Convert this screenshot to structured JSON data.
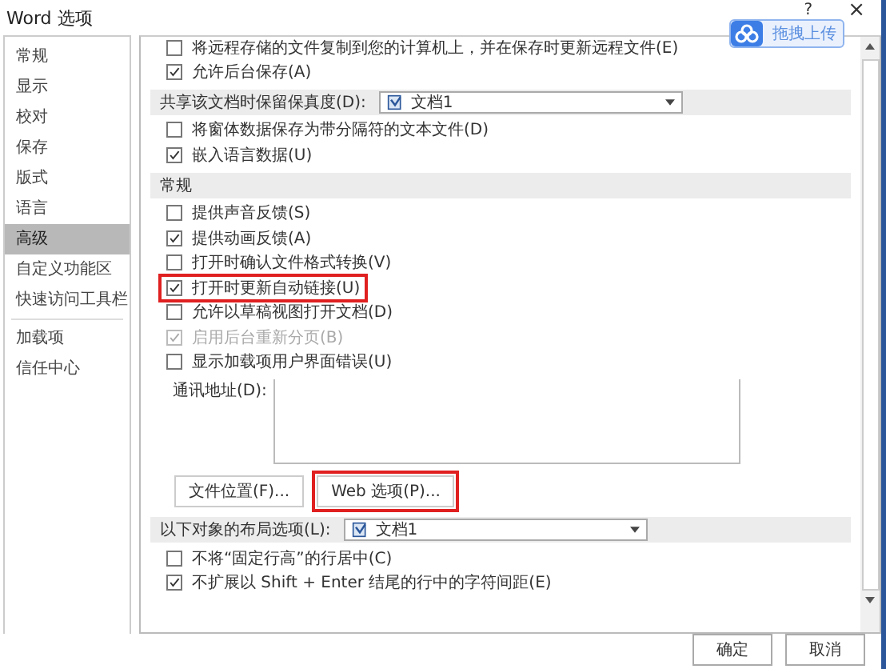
{
  "window": {
    "title": "Word 选项",
    "help": "?",
    "close": "×"
  },
  "upload_badge": {
    "label": "拖拽上传"
  },
  "sidebar": {
    "groups": [
      [
        {
          "label": "常规",
          "selected": false
        },
        {
          "label": "显示",
          "selected": false
        },
        {
          "label": "校对",
          "selected": false
        },
        {
          "label": "保存",
          "selected": false
        },
        {
          "label": "版式",
          "selected": false
        },
        {
          "label": "语言",
          "selected": false
        },
        {
          "label": "高级",
          "selected": true
        },
        {
          "label": "自定义功能区",
          "selected": false
        },
        {
          "label": "快速访问工具栏",
          "selected": false
        }
      ],
      [
        {
          "label": "加载项",
          "selected": false
        },
        {
          "label": "信任中心",
          "selected": false
        }
      ]
    ]
  },
  "content": {
    "rows": [
      {
        "kind": "checkbox",
        "label": "将远程存储的文件复制到您的计算机上，并在保存时更新远程文件(E)",
        "checked": false,
        "disabled": false,
        "highlighted": false
      },
      {
        "kind": "checkbox",
        "label": "允许后台保存(A)",
        "checked": true,
        "disabled": false,
        "highlighted": false
      },
      {
        "kind": "header",
        "label": "共享该文档时保留保真度(D):",
        "select": "文档1"
      },
      {
        "kind": "checkbox",
        "label": "将窗体数据保存为带分隔符的文本文件(D)",
        "checked": false,
        "disabled": false,
        "highlighted": false
      },
      {
        "kind": "checkbox",
        "label": "嵌入语言数据(U)",
        "checked": true,
        "disabled": false,
        "highlighted": false
      },
      {
        "kind": "header",
        "label": "常规"
      },
      {
        "kind": "checkbox",
        "label": "提供声音反馈(S)",
        "checked": false,
        "disabled": false,
        "highlighted": false
      },
      {
        "kind": "checkbox",
        "label": "提供动画反馈(A)",
        "checked": true,
        "disabled": false,
        "highlighted": false
      },
      {
        "kind": "checkbox",
        "label": "打开时确认文件格式转换(V)",
        "checked": false,
        "disabled": false,
        "highlighted": false
      },
      {
        "kind": "checkbox",
        "label": "打开时更新自动链接(U)",
        "checked": true,
        "disabled": false,
        "highlighted": true
      },
      {
        "kind": "checkbox",
        "label": "允许以草稿视图打开文档(D)",
        "checked": false,
        "disabled": false,
        "highlighted": false
      },
      {
        "kind": "checkbox",
        "label": "启用后台重新分页(B)",
        "checked": true,
        "disabled": true,
        "highlighted": false
      },
      {
        "kind": "checkbox",
        "label": "显示加载项用户界面错误(U)",
        "checked": false,
        "disabled": false,
        "highlighted": false
      },
      {
        "kind": "address",
        "label": "通讯地址(D):"
      },
      {
        "kind": "buttons",
        "buttons": [
          {
            "label": "文件位置(F)...",
            "highlighted": false
          },
          {
            "label": "Web 选项(P)...",
            "highlighted": true
          }
        ]
      },
      {
        "kind": "header",
        "label": "以下对象的布局选项(L):",
        "select": "文档1"
      },
      {
        "kind": "checkbox",
        "label": "不将“固定行高”的行居中(C)",
        "checked": false,
        "disabled": false,
        "highlighted": false
      },
      {
        "kind": "checkbox",
        "label": "不扩展以 Shift + Enter 结尾的行中的字符间距(E)",
        "checked": true,
        "disabled": false,
        "highlighted": false
      }
    ]
  },
  "footer": {
    "buttons": [
      "确定",
      "取消"
    ]
  }
}
